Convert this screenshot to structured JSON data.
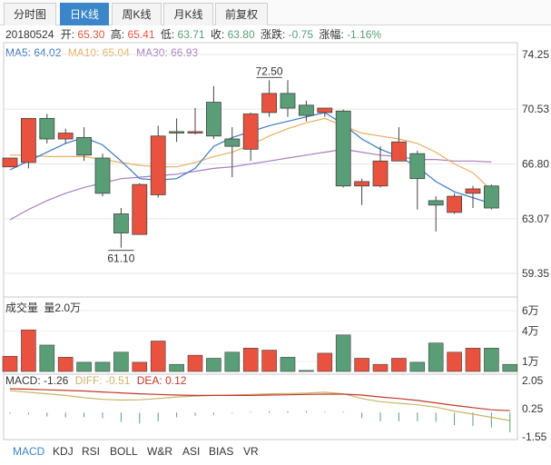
{
  "tabs": [
    {
      "label": "分时图",
      "active": false
    },
    {
      "label": "日K线",
      "active": true
    },
    {
      "label": "周K线",
      "active": false
    },
    {
      "label": "月K线",
      "active": false
    },
    {
      "label": "前复权",
      "active": false
    }
  ],
  "info": {
    "date": "20180524",
    "open_label": "开:",
    "open": "65.30",
    "high_label": "高:",
    "high": "65.41",
    "low_label": "低:",
    "low": "63.71",
    "close_label": "收:",
    "close": "63.80",
    "change_label": "涨跌:",
    "change": "-0.75",
    "pct_label": "涨幅:",
    "pct": "-1.16%"
  },
  "ma": {
    "ma5": "MA5: 64.02",
    "ma10": "MA10: 65.04",
    "ma30": "MA30: 66.93"
  },
  "volume": {
    "title": "成交量",
    "unit_label": "量2.0万"
  },
  "macd": {
    "macd": "MACD: -1.26",
    "diff": "DIFF: -0.51",
    "dea": "DEA: 0.12"
  },
  "bottom_tabs": [
    "MACD",
    "KDJ",
    "RSI",
    "BOLL",
    "W&R",
    "ASI",
    "BIAS",
    "VR"
  ],
  "colors": {
    "up": "#e8523f",
    "down": "#5a9e77",
    "ma5": "#3b78c2",
    "ma10": "#e6b061",
    "ma30": "#a77fbf",
    "diff": "#c9b46a",
    "dea": "#c0392b",
    "active_tab": "#3a86c8"
  },
  "chart_data": [
    {
      "type": "candlestick",
      "price_axis": {
        "ticks": [
          "74.25",
          "70.53",
          "66.80",
          "63.07",
          "59.35"
        ],
        "ylim": [
          59.35,
          74.25
        ]
      },
      "annotations": [
        {
          "text": "72.50",
          "candle_index": 14,
          "value": 72.5
        },
        {
          "text": "61.10",
          "candle_index": 6,
          "value": 61.1
        }
      ],
      "candles": [
        {
          "o": 66.6,
          "c": 67.2,
          "h": 67.2,
          "l": 66.6
        },
        {
          "o": 66.9,
          "c": 69.9,
          "h": 69.9,
          "l": 66.5
        },
        {
          "o": 69.9,
          "c": 68.5,
          "h": 70.2,
          "l": 68.2
        },
        {
          "o": 68.5,
          "c": 68.9,
          "h": 69.2,
          "l": 68.2
        },
        {
          "o": 68.6,
          "c": 67.4,
          "h": 69.3,
          "l": 67.0
        },
        {
          "o": 67.2,
          "c": 64.8,
          "h": 67.5,
          "l": 64.6
        },
        {
          "o": 63.4,
          "c": 62.1,
          "h": 63.8,
          "l": 61.1
        },
        {
          "o": 62.0,
          "c": 65.4,
          "h": 65.5,
          "l": 62.0
        },
        {
          "o": 64.7,
          "c": 68.7,
          "h": 69.4,
          "l": 64.5
        },
        {
          "o": 69.0,
          "c": 68.9,
          "h": 69.9,
          "l": 68.3
        },
        {
          "o": 68.9,
          "c": 69.0,
          "h": 70.6,
          "l": 68.8
        },
        {
          "o": 71.0,
          "c": 68.7,
          "h": 72.1,
          "l": 68.5
        },
        {
          "o": 68.5,
          "c": 68.0,
          "h": 69.3,
          "l": 65.9
        },
        {
          "o": 67.8,
          "c": 70.2,
          "h": 70.3,
          "l": 67.0
        },
        {
          "o": 70.3,
          "c": 71.6,
          "h": 72.5,
          "l": 70.0
        },
        {
          "o": 71.6,
          "c": 70.6,
          "h": 72.5,
          "l": 70.0
        },
        {
          "o": 70.8,
          "c": 70.1,
          "h": 71.1,
          "l": 69.7
        },
        {
          "o": 70.3,
          "c": 70.6,
          "h": 70.6,
          "l": 70.0
        },
        {
          "o": 70.4,
          "c": 65.3,
          "h": 70.5,
          "l": 65.2
        },
        {
          "o": 65.3,
          "c": 65.6,
          "h": 65.8,
          "l": 64.0
        },
        {
          "o": 65.3,
          "c": 67.0,
          "h": 68.0,
          "l": 65.2
        },
        {
          "o": 67.0,
          "c": 68.3,
          "h": 69.3,
          "l": 67.0
        },
        {
          "o": 67.5,
          "c": 65.8,
          "h": 67.7,
          "l": 63.7
        },
        {
          "o": 64.3,
          "c": 64.0,
          "h": 64.6,
          "l": 62.2
        },
        {
          "o": 63.5,
          "c": 64.6,
          "h": 64.8,
          "l": 63.4
        },
        {
          "o": 64.8,
          "c": 65.1,
          "h": 65.3,
          "l": 63.8
        },
        {
          "o": 65.3,
          "c": 63.8,
          "h": 65.4,
          "l": 63.7
        }
      ],
      "ma5": [
        66.4,
        67.0,
        67.6,
        68.2,
        68.6,
        68.1,
        67.0,
        65.8,
        65.7,
        65.8,
        66.5,
        68.0,
        68.6,
        69.0,
        69.4,
        69.7,
        70.0,
        70.3,
        69.5,
        68.5,
        67.8,
        67.3,
        66.6,
        65.6,
        64.9,
        64.5,
        64.1
      ],
      "ma10": [
        67.4,
        67.4,
        67.3,
        67.3,
        67.3,
        67.1,
        66.9,
        66.7,
        66.6,
        66.6,
        66.9,
        67.3,
        67.6,
        68.1,
        68.7,
        69.2,
        69.6,
        69.9,
        69.4,
        68.9,
        68.7,
        68.5,
        68.2,
        67.6,
        66.8,
        66.2,
        65.0
      ],
      "ma30": [
        63.0,
        63.7,
        64.3,
        64.8,
        65.2,
        65.5,
        65.8,
        65.9,
        66.0,
        66.1,
        66.3,
        66.5,
        66.6,
        66.8,
        67.0,
        67.2,
        67.4,
        67.6,
        67.8,
        67.6,
        67.4,
        67.3,
        67.1,
        67.1,
        67.0,
        67.0,
        66.93
      ]
    },
    {
      "type": "bar",
      "title": "成交量",
      "axis": {
        "ticks": [
          "6万",
          "4万",
          "1万"
        ],
        "ylim": [
          0,
          6.0
        ]
      },
      "unit": "万",
      "values": [
        1.5,
        4.1,
        2.6,
        1.4,
        0.9,
        0.9,
        1.9,
        0.9,
        3.0,
        0.7,
        1.6,
        1.3,
        1.9,
        2.3,
        2.1,
        1.4,
        0.1,
        1.8,
        3.6,
        1.3,
        0.7,
        1.3,
        0.9,
        2.8,
        1.9,
        2.3,
        2.3,
        0.7
      ]
    },
    {
      "type": "line",
      "title": "MACD",
      "axis": {
        "ticks": [
          "2.05",
          "0.25",
          "-1.55"
        ],
        "ylim": [
          -1.55,
          2.05
        ]
      },
      "dea": [
        1.52,
        1.5,
        1.46,
        1.42,
        1.38,
        1.32,
        1.26,
        1.2,
        1.16,
        1.12,
        1.1,
        1.1,
        1.1,
        1.1,
        1.12,
        1.14,
        1.16,
        1.18,
        1.18,
        1.12,
        1.0,
        0.9,
        0.78,
        0.62,
        0.46,
        0.32,
        0.18,
        0.12
      ],
      "diff": [
        1.4,
        1.3,
        1.2,
        1.1,
        0.95,
        0.85,
        0.8,
        0.82,
        0.9,
        1.0,
        1.05,
        1.1,
        1.12,
        1.16,
        1.2,
        1.22,
        1.24,
        1.3,
        1.2,
        0.9,
        0.7,
        0.6,
        0.5,
        0.35,
        0.1,
        -0.1,
        -0.3,
        -0.51
      ],
      "macd_bars": [
        -0.08,
        -0.12,
        -0.25,
        -0.3,
        -0.3,
        -0.35,
        -0.6,
        -0.7,
        -0.55,
        -0.3,
        -0.2,
        -0.15,
        -0.05,
        0.05,
        0.1,
        0.1,
        0.1,
        0.05,
        0.05,
        -0.35,
        -0.55,
        -0.55,
        -0.55,
        -0.6,
        -0.8,
        -0.85,
        -0.95,
        -1.26
      ]
    }
  ]
}
